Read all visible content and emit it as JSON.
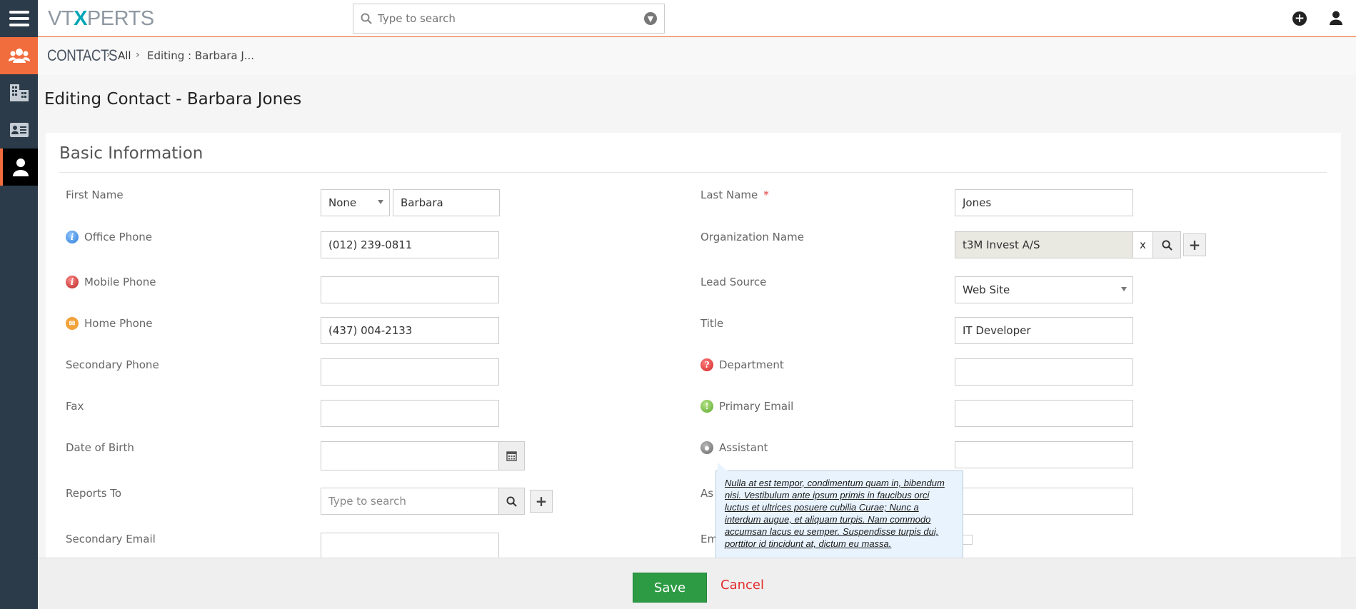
{
  "header": {
    "logo_prefix": "VT",
    "logo_x": "X",
    "logo_suffix": "PERTS",
    "search_placeholder": "Type to search"
  },
  "breadcrumb": {
    "module": "CONTACTS",
    "all": "All",
    "current": "Editing : Barbara J..."
  },
  "page_title": "Editing Contact - Barbara Jones",
  "section_title": "Basic Information",
  "fields": {
    "first_name": {
      "label": "First Name",
      "salutation": "None",
      "value": "Barbara"
    },
    "last_name": {
      "label": "Last Name",
      "required": "*",
      "value": "Jones"
    },
    "office_phone": {
      "label": "Office Phone",
      "value": "(012) 239-0811"
    },
    "organization_name": {
      "label": "Organization Name",
      "value": "t3M Invest A/S",
      "clear": "x"
    },
    "mobile_phone": {
      "label": "Mobile Phone",
      "value": ""
    },
    "lead_source": {
      "label": "Lead Source",
      "value": "Web Site"
    },
    "home_phone": {
      "label": "Home Phone",
      "value": "(437) 004-2133"
    },
    "title": {
      "label": "Title",
      "value": "IT Developer"
    },
    "secondary_phone": {
      "label": "Secondary Phone",
      "value": ""
    },
    "department": {
      "label": "Department",
      "value": ""
    },
    "fax": {
      "label": "Fax",
      "value": ""
    },
    "primary_email": {
      "label": "Primary Email",
      "value": ""
    },
    "date_of_birth": {
      "label": "Date of Birth",
      "value": ""
    },
    "assistant": {
      "label": "Assistant",
      "value": ""
    },
    "reports_to": {
      "label": "Reports To",
      "placeholder": "Type to search"
    },
    "assistant_phone": {
      "label_visible": "As"
    },
    "secondary_email": {
      "label": "Secondary Email",
      "value": ""
    },
    "email_opt_out": {
      "label_visible": "Em"
    }
  },
  "tooltip": {
    "text": "Nulla at est tempor, condimentum quam in, bibendum nisi. Vestibulum ante ipsum primis in faucibus orci luctus et ultrices posuere cubilia Curae; Nunc a interdum augue, et aliquam turpis. Nam commodo accumsan lacus eu semper. Suspendisse turpis dui, porttitor id tincidunt at, dictum eu massa."
  },
  "footer": {
    "save_label": "Save",
    "cancel_label": "Cancel"
  },
  "colors": {
    "accent": "#f26d3d",
    "rail": "#2c3b49",
    "save": "#2d9b44",
    "cancel": "#e22b2b"
  }
}
